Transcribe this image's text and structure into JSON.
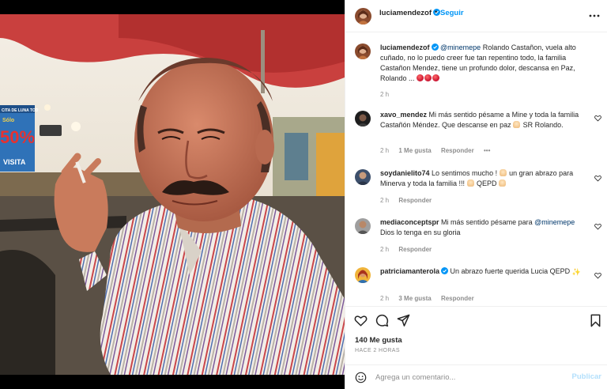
{
  "post": {
    "author": "luciamendezof",
    "follow_label": "Seguir",
    "separator": "•",
    "photo_sign": {
      "line1": "CITA DE LUNA TOD",
      "line2": "Sólo",
      "percent": "50%",
      "line3": "VISITA"
    }
  },
  "caption": {
    "author": "luciamendezof",
    "mention": "@minemepe",
    "text": " Rolando Castañon, vuela alto cuñado, no lo puedo creer fue tan repentino todo, la familia Castañon Mendez, tiene un profundo dolor, descansa en Paz, Rolando ...",
    "time": "2 h"
  },
  "comments": [
    {
      "user": "xavo_mendez",
      "text": " Mi más sentido pésame a Mine y toda la familia Castañón Méndez. Que descanse en paz ",
      "text_end": " SR Rolando.",
      "time": "2 h",
      "likes": "1 Me gusta",
      "reply": "Responder",
      "more": "•••"
    },
    {
      "user": "soydanielito74",
      "text": " Lo sentimos mucho ! ",
      "text_mid": " un gran abrazo para Minerva y toda la familia !!! ",
      "text_end": " QEPD ",
      "time": "2 h",
      "reply": "Responder"
    },
    {
      "user": "mediaconceptspr",
      "text": " Mi más sentido pésame para ",
      "mention": "@minemepe",
      "text_end": " Dios lo tenga en su gloria",
      "time": "2 h",
      "reply": "Responder"
    },
    {
      "user": "patriciamanterola",
      "text": " Un abrazo fuerte querida Lucia QEPD ",
      "spark": "✨",
      "time": "2 h",
      "likes": "3 Me gusta",
      "reply": "Responder"
    }
  ],
  "stats": {
    "likes": "140 Me gusta",
    "time_ago": "HACE 2 HORAS"
  },
  "composer": {
    "placeholder": "Agrega un comentario...",
    "publish_label": "Publicar"
  },
  "colors": {
    "accent": "#0095f6",
    "mention": "#00376b",
    "muted": "#8e8e8e",
    "publish_disabled": "#b2dffc"
  },
  "icons": [
    "verified-badge-icon",
    "more-options-icon",
    "heart-icon",
    "comment-icon",
    "share-icon",
    "bookmark-icon",
    "emoji-icon"
  ]
}
